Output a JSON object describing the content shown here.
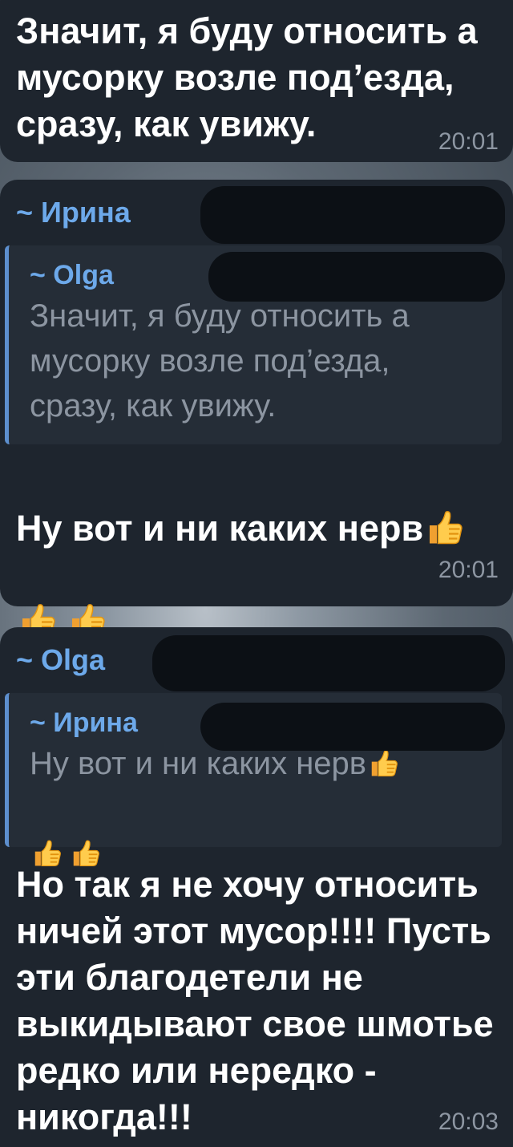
{
  "messages": [
    {
      "text": "Значит, я буду относить а мусорку возле под’езда, сразу, как увижу.",
      "time": "20:01"
    },
    {
      "sender": "~ Ирина",
      "reply": {
        "sender": "~ Olga",
        "text": "Значит, я буду относить а мусорку возле под’езда, сразу, как увижу."
      },
      "text": "Ну вот и ни каких нерв",
      "emoji": "thumbs-up-icon",
      "time": "20:01"
    },
    {
      "sender": "~ Olga",
      "reply": {
        "sender": "~ Ирина",
        "text": "Ну вот и ни каких нерв"
      },
      "text": "Но так я не хочу относить ничей этот мусор!!!! Пусть эти благодетели не выкидывают свое шмотье редко или нередко - никогда!!!",
      "time": "20:03"
    }
  ],
  "colors": {
    "bubble": "#1e252e",
    "sender": "#6da9ea",
    "time": "#8d96a2",
    "reply_bar": "#5d8fce"
  }
}
